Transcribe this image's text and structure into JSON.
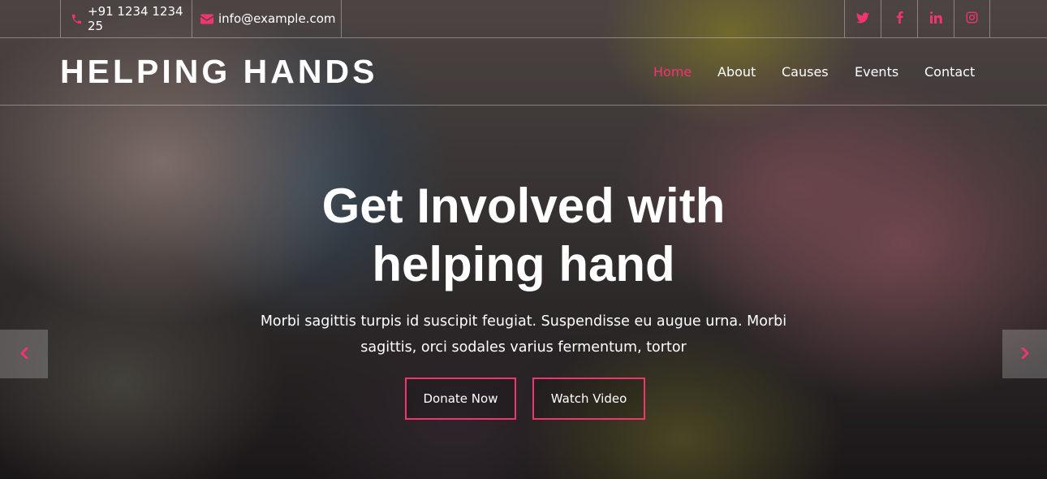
{
  "colors": {
    "accent": "#f0356f",
    "text": "#ffffff"
  },
  "topbar": {
    "phone": {
      "icon": "phone-icon",
      "text": "+91 1234 1234 25"
    },
    "email": {
      "icon": "envelope-icon",
      "text": "info@example.com"
    },
    "social": [
      {
        "name": "twitter-icon"
      },
      {
        "name": "facebook-icon"
      },
      {
        "name": "linkedin-icon"
      },
      {
        "name": "instagram-icon"
      }
    ]
  },
  "header": {
    "logo": "HELPING HANDS",
    "nav": [
      {
        "label": "Home",
        "active": true
      },
      {
        "label": "About",
        "active": false
      },
      {
        "label": "Causes",
        "active": false
      },
      {
        "label": "Events",
        "active": false
      },
      {
        "label": "Contact",
        "active": false
      }
    ]
  },
  "hero": {
    "title_line1": "Get Involved with",
    "title_line2": "helping hand",
    "text_line1": "Morbi sagittis turpis id suscipit feugiat. Suspendisse eu augue urna. Morbi",
    "text_line2": "sagittis, orci sodales varius fermentum, tortor",
    "donate_label": "Donate Now",
    "watch_label": "Watch Video",
    "prev_icon": "chevron-left-icon",
    "next_icon": "chevron-right-icon"
  }
}
